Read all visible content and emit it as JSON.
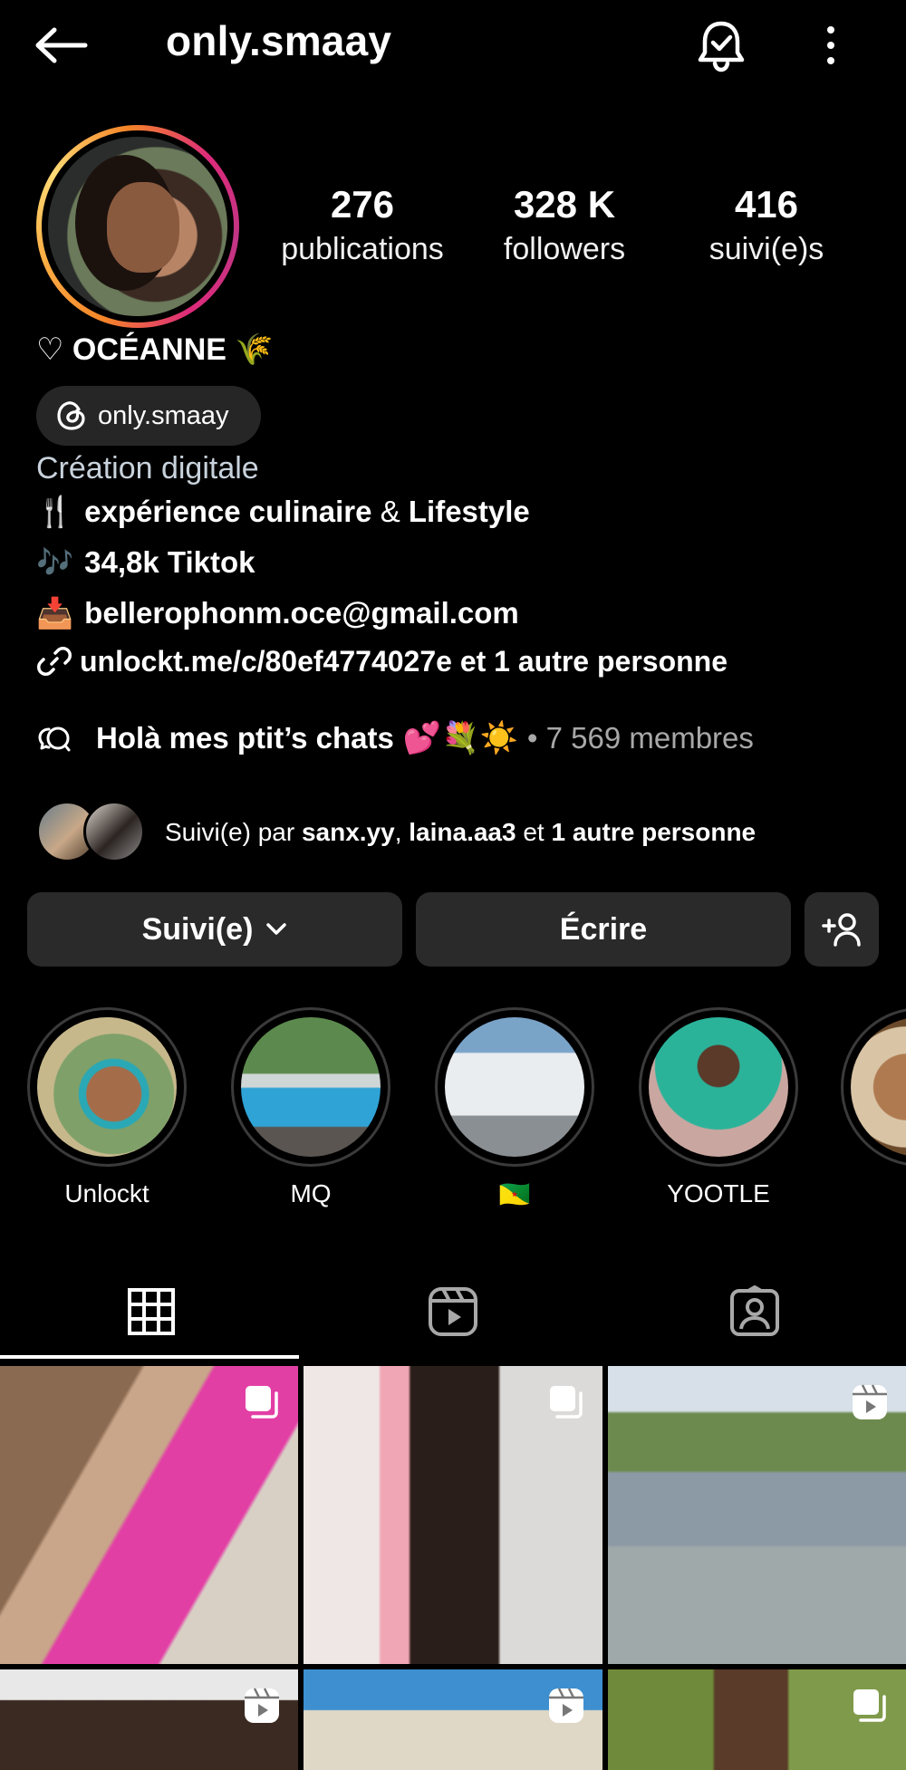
{
  "header": {
    "username": "only.smaay",
    "back_icon": "arrow-left-icon",
    "notification_icon": "bell-icon",
    "more_icon": "more-vertical-icon"
  },
  "profile": {
    "stats": [
      {
        "value": "276",
        "label": "publications"
      },
      {
        "value": "328 K",
        "label": "followers"
      },
      {
        "value": "416",
        "label": "suivi(e)s"
      }
    ],
    "display_name": "♡ OCÉANNE 🌾",
    "threads_handle": "only.smaay",
    "category": "Création digitale",
    "bio": {
      "line1_emoji": "🍴",
      "line1_a": "expérience culinaire",
      "line1_amp": "&",
      "line1_b": "Lifestyle",
      "line2_emoji": "🎶",
      "line2_text": "34,8k Tiktok",
      "line3_emoji": "📥",
      "line3_text": "bellerophonm.oce@gmail.com"
    },
    "link": "unlockt.me/c/80ef4774027e et 1 autre personne",
    "channel": {
      "name": "Holà mes ptit’s chats",
      "emojis": "💕💐☀️",
      "members": "• 7 569 membres"
    },
    "followed_by": {
      "prefix": "Suivi(e) par",
      "user1": "sanx.yy",
      "sep": ",",
      "user2": "laina.aa3",
      "middle": "et",
      "rest": "1 autre personne"
    }
  },
  "actions": {
    "following_label": "Suivi(e)",
    "message_label": "Écrire",
    "add_icon": "person-add-icon"
  },
  "highlights": [
    {
      "label": "Unlockt"
    },
    {
      "label": "MQ"
    },
    {
      "label": "🇬🇫"
    },
    {
      "label": "YOOTLE"
    },
    {
      "label": ""
    }
  ],
  "tabs": [
    {
      "name": "grid-icon",
      "selected": true
    },
    {
      "name": "reels-icon",
      "selected": false
    },
    {
      "name": "tagged-icon",
      "selected": false
    }
  ],
  "posts": [
    {
      "type": "carousel"
    },
    {
      "type": "carousel"
    },
    {
      "type": "reel"
    },
    {
      "type": "reel"
    },
    {
      "type": "reel"
    },
    {
      "type": "carousel"
    }
  ],
  "colors": {
    "background": "#000000",
    "button_bg": "#2a2a2a",
    "muted_text": "#a8a8a8",
    "ring_start": "#f58529",
    "ring_end": "#c13584"
  }
}
